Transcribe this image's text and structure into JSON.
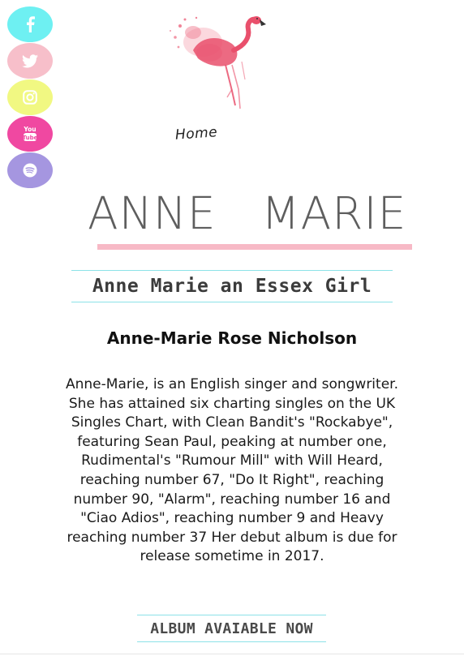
{
  "social": [
    {
      "name": "facebook",
      "icon": "facebook-icon",
      "color": "#6ef0f2"
    },
    {
      "name": "twitter",
      "icon": "twitter-icon",
      "color": "#f7bfca"
    },
    {
      "name": "instagram",
      "icon": "instagram-icon",
      "color": "#f1f882"
    },
    {
      "name": "youtube",
      "icon": "youtube-icon",
      "color": "#f048a1"
    },
    {
      "name": "spotify",
      "icon": "spotify-icon",
      "color": "#a596e0"
    }
  ],
  "logo": {
    "icon": "flamingo-icon",
    "accent": "#e9506c"
  },
  "nav": {
    "home_label": "Home"
  },
  "header": {
    "title": "ANNE   MARIE",
    "underline_color": "#f7b9c6"
  },
  "main": {
    "subtitle": "Anne Marie an Essex Girl",
    "full_name": "Anne-Marie Rose Nicholson",
    "bio": "Anne-Marie, is an English singer and songwriter. She has attained six charting singles on the UK Singles Chart, with Clean Bandit's \"Rockabye\", featuring Sean Paul, peaking at number one, Rudimental's \"Rumour Mill\" with Will Heard, reaching number 67, \"Do It Right\", reaching number 90, \"Alarm\", reaching number 16 and \"Ciao Adios\", reaching number 9 and Heavy reaching number 37 Her debut album is due for release sometime in 2017.",
    "album_label": "ALBUM AVAIABLE NOW",
    "rule_color": "#8ce2e8"
  }
}
